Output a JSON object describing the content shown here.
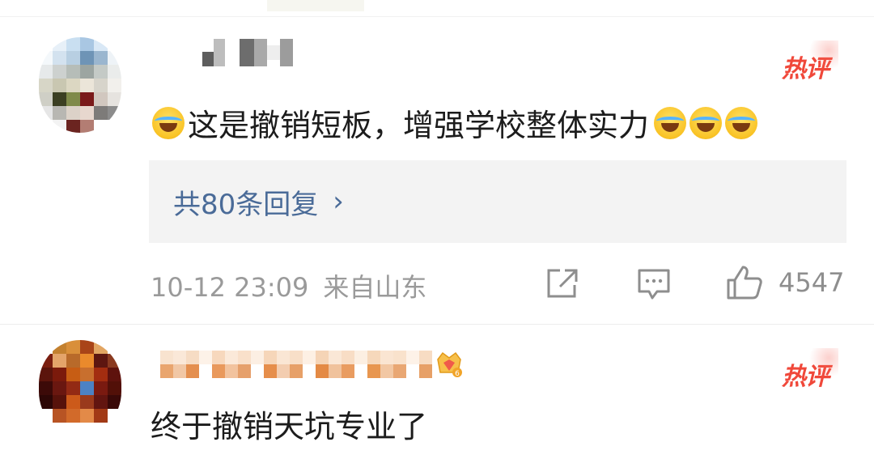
{
  "comments": [
    {
      "text_before_emoji": "",
      "text": "这是撤销短板，增强学校整体实力",
      "hot_label": "热评",
      "reply_label": "共80条回复",
      "reply_chevron": "›",
      "timestamp": "10-12 23:09",
      "location": "来自山东",
      "like_count": "4547",
      "emoji_leading": "laugh-cry-emoji",
      "emoji_trailing_count": 3
    },
    {
      "text": "终于撤销天坑专业了",
      "hot_label": "热评",
      "vip_level": "6"
    }
  ],
  "colors": {
    "hot": "#f0483a",
    "link": "#4a6b98",
    "meta": "#9a9a9a",
    "text": "#1c1c1c",
    "reply_bg": "#f3f3f3"
  },
  "icons": {
    "share": "share-icon",
    "comment": "comment-icon",
    "like": "thumbs-up-icon",
    "chevron": "chevron-right-icon",
    "vip": "crown-badge-icon"
  }
}
